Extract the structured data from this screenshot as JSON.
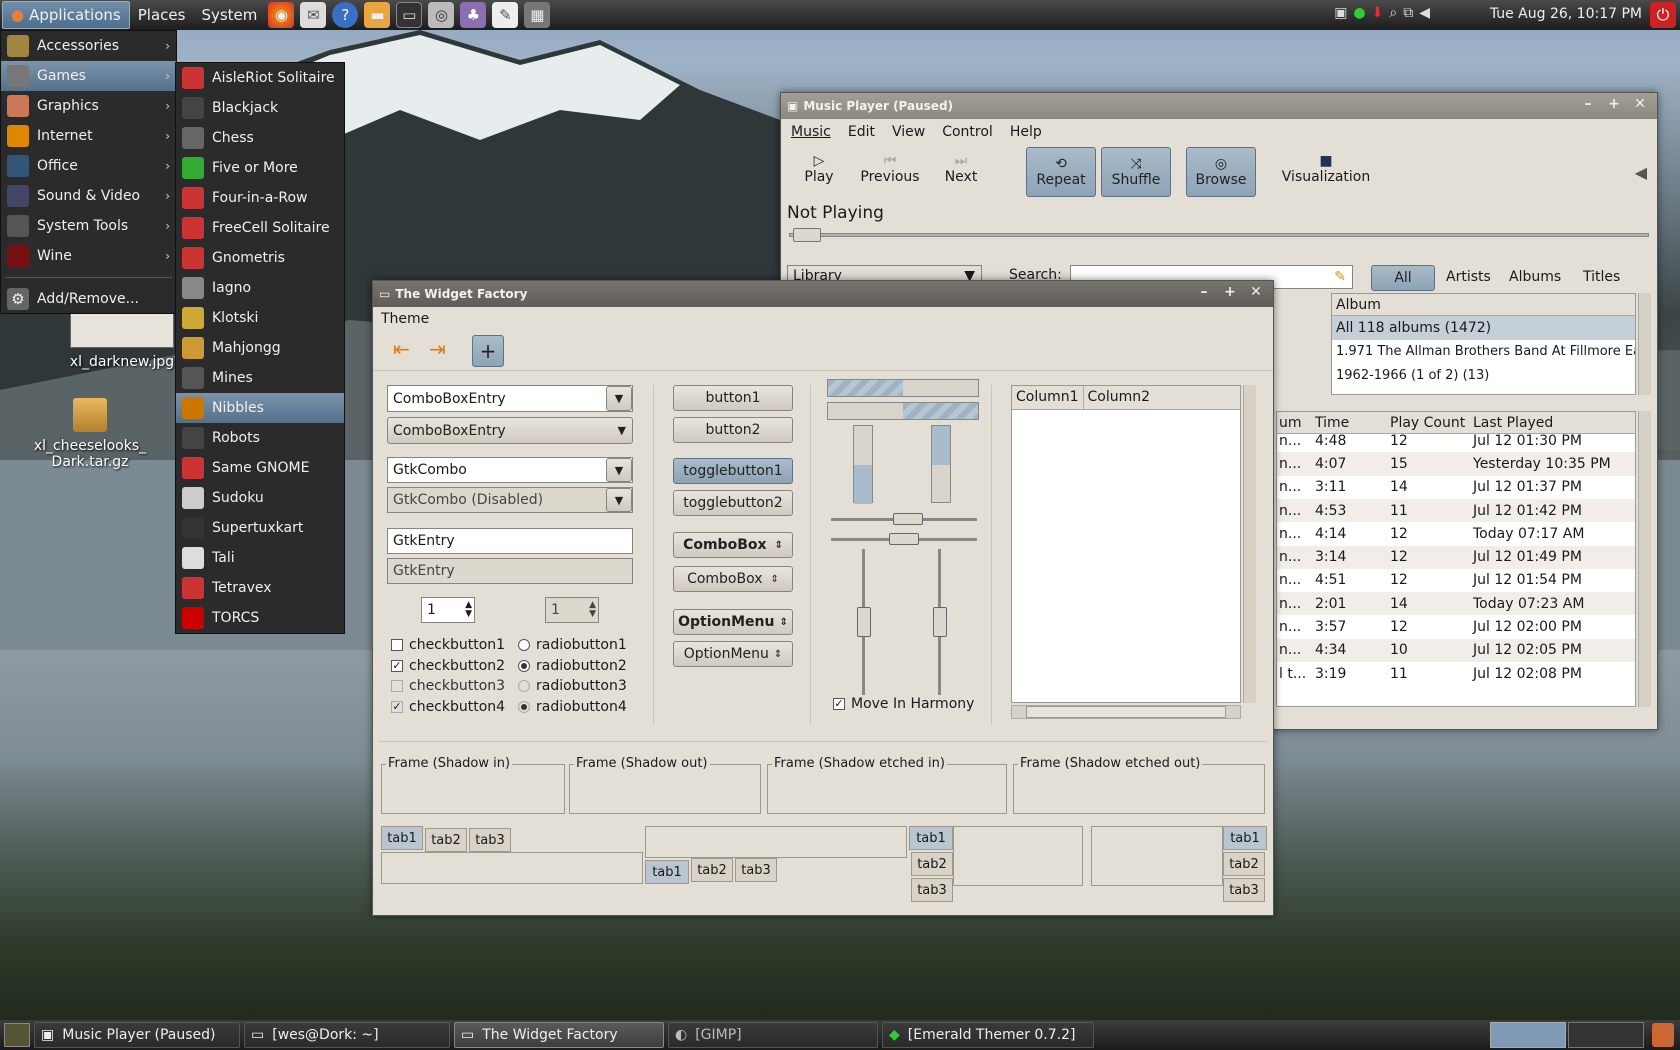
{
  "top_panel": {
    "menus": [
      "Applications",
      "Places",
      "System"
    ],
    "clock": "Tue Aug 26, 10:17 PM"
  },
  "app_menu": {
    "categories": [
      {
        "label": "Accessories",
        "icon": "accessories-icon"
      },
      {
        "label": "Games",
        "icon": "games-icon"
      },
      {
        "label": "Graphics",
        "icon": "graphics-icon"
      },
      {
        "label": "Internet",
        "icon": "internet-icon"
      },
      {
        "label": "Office",
        "icon": "office-icon"
      },
      {
        "label": "Sound & Video",
        "icon": "sound-video-icon"
      },
      {
        "label": "System Tools",
        "icon": "system-tools-icon"
      },
      {
        "label": "Wine",
        "icon": "wine-icon"
      }
    ],
    "add_remove": "Add/Remove...",
    "games": [
      "AisleRiot Solitaire",
      "Blackjack",
      "Chess",
      "Five or More",
      "Four-in-a-Row",
      "FreeCell Solitaire",
      "Gnometris",
      "Iagno",
      "Klotski",
      "Mahjongg",
      "Mines",
      "Nibbles",
      "Robots",
      "Same GNOME",
      "Sudoku",
      "Supertuxkart",
      "Tali",
      "Tetravex",
      "TORCS"
    ]
  },
  "desktop": {
    "icons": [
      "xl_darknew.jpg",
      "xl_cheeselooks_",
      "Dark.tar.gz"
    ]
  },
  "music_player": {
    "title": "Music Player (Paused)",
    "menus": [
      "Music",
      "Edit",
      "View",
      "Control",
      "Help"
    ],
    "toolbar": [
      "Play",
      "Previous",
      "Next",
      "Repeat",
      "Shuffle",
      "Browse",
      "Visualization"
    ],
    "now_playing": "Not Playing",
    "source": "Library",
    "search_label": "Search:",
    "filters": [
      "All",
      "Artists",
      "Albums",
      "Titles"
    ],
    "album_header": "Album",
    "albums": [
      "All 118 albums (1472)",
      "1.971 The Allman Brothers Band At Fillmore Ea",
      "1962-1966 (1 of 2) (13)"
    ],
    "columns": [
      "um",
      "Time",
      "Play Count",
      "Last Played"
    ],
    "tracks": [
      [
        "n...",
        "4:48",
        "12",
        "Jul 12 01:30 PM"
      ],
      [
        "n...",
        "4:07",
        "15",
        "Yesterday 10:35 PM"
      ],
      [
        "n...",
        "3:11",
        "14",
        "Jul 12 01:37 PM"
      ],
      [
        "n...",
        "4:53",
        "11",
        "Jul 12 01:42 PM"
      ],
      [
        "n...",
        "4:14",
        "12",
        "Today 07:17 AM"
      ],
      [
        "n...",
        "3:14",
        "12",
        "Jul 12 01:49 PM"
      ],
      [
        "n...",
        "4:51",
        "12",
        "Jul 12 01:54 PM"
      ],
      [
        "n...",
        "2:01",
        "14",
        "Today 07:23 AM"
      ],
      [
        "n...",
        "3:57",
        "12",
        "Jul 12 02:00 PM"
      ],
      [
        "n...",
        "4:34",
        "10",
        "Jul 12 02:05 PM"
      ],
      [
        "l t...",
        "3:19",
        "11",
        "Jul 12 02:08 PM"
      ]
    ]
  },
  "widget_factory": {
    "title": "The Widget Factory",
    "menu": "Theme",
    "combo_entry1": "ComboBoxEntry",
    "combo_entry2": "ComboBoxEntry",
    "gtk_combo": "GtkCombo",
    "gtk_combo_disabled": "GtkCombo (Disabled)",
    "entry1": "GtkEntry",
    "entry2": "GtkEntry",
    "spin1": "1",
    "spin2": "1",
    "checks": [
      "checkbutton1",
      "checkbutton2",
      "checkbutton3",
      "checkbutton4"
    ],
    "radios": [
      "radiobutton1",
      "radiobutton2",
      "radiobutton3",
      "radiobutton4"
    ],
    "buttons": [
      "button1",
      "button2"
    ],
    "toggles": [
      "togglebutton1",
      "togglebutton2"
    ],
    "comboboxes": [
      "ComboBox",
      "ComboBox"
    ],
    "option_menus": [
      "OptionMenu",
      "OptionMenu"
    ],
    "move_in_harmony": "Move In Harmony",
    "tree_columns": [
      "Column1",
      "Column2"
    ],
    "frames": [
      "Frame (Shadow in)",
      "Frame (Shadow out)",
      "Frame (Shadow etched in)",
      "Frame (Shadow etched out)"
    ],
    "tabs": [
      "tab1",
      "tab2",
      "tab3"
    ]
  },
  "taskbar": [
    "Music Player (Paused)",
    "[wes@Dork: ~]",
    "The Widget Factory",
    "[GIMP]",
    "[Emerald Themer 0.7.2]"
  ]
}
